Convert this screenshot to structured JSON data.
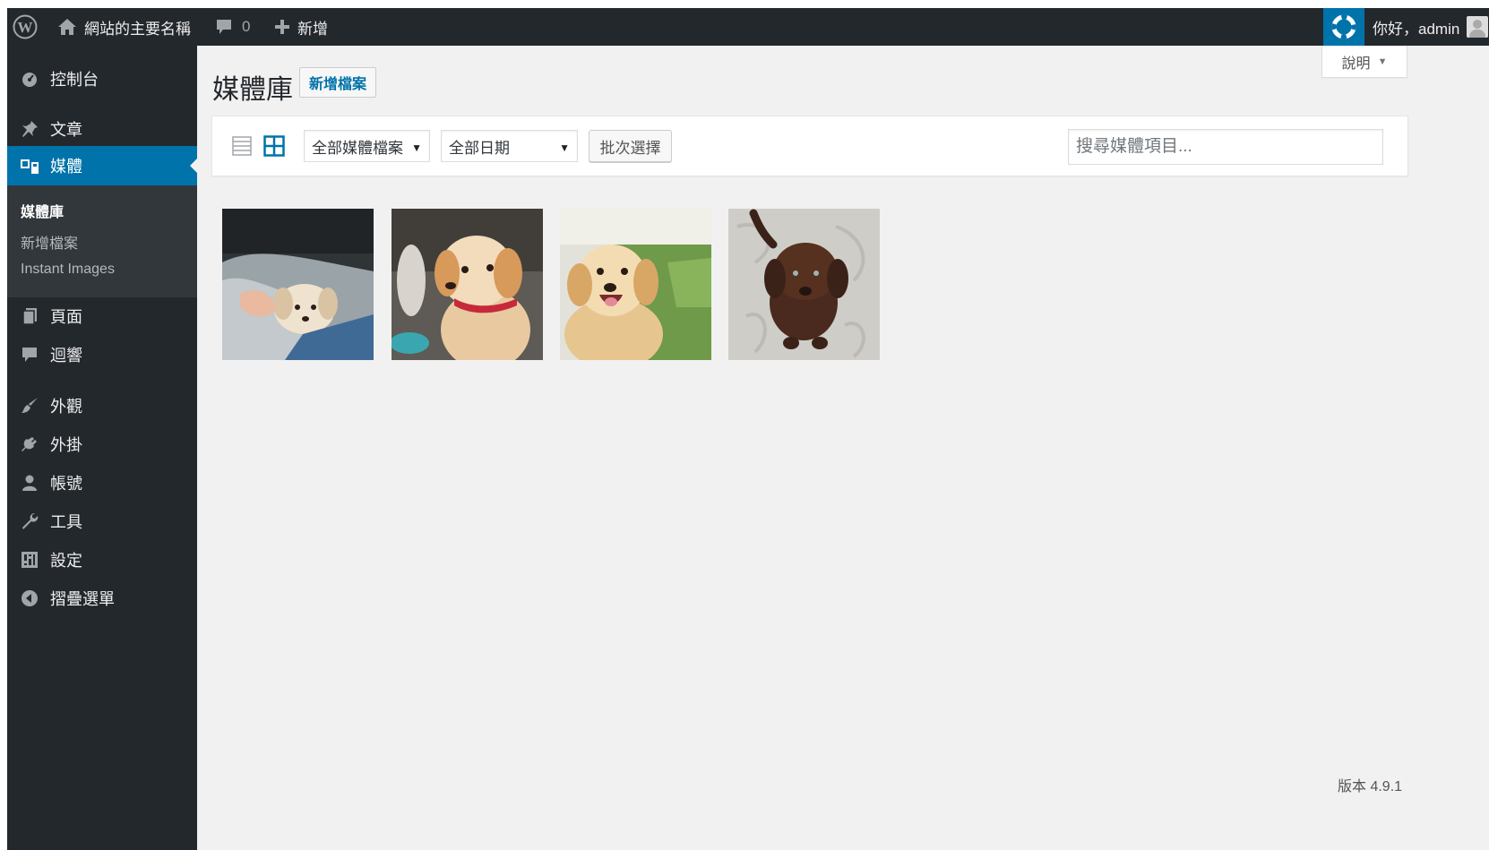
{
  "adminbar": {
    "site_name": "網站的主要名稱",
    "comments_count": "0",
    "new_label": "新增",
    "greeting": "你好，admin",
    "icons": [
      "wordpress-icon",
      "home-icon",
      "comment-icon",
      "plus-icon",
      "help-lifesaver-icon",
      "avatar"
    ]
  },
  "sidebar": {
    "items": [
      {
        "label": "控制台",
        "icon": "dashboard-icon"
      },
      {
        "label": "文章",
        "icon": "pushpin-icon"
      },
      {
        "label": "媒體",
        "icon": "media-icon"
      },
      {
        "label": "頁面",
        "icon": "page-icon"
      },
      {
        "label": "迴響",
        "icon": "comment-icon"
      },
      {
        "label": "外觀",
        "icon": "paintbrush-icon"
      },
      {
        "label": "外掛",
        "icon": "plugin-icon"
      },
      {
        "label": "帳號",
        "icon": "user-icon"
      },
      {
        "label": "工具",
        "icon": "wrench-icon"
      },
      {
        "label": "設定",
        "icon": "settings-icon"
      },
      {
        "label": "摺疊選單",
        "icon": "collapse-icon"
      }
    ],
    "submenu": [
      {
        "label": "媒體庫"
      },
      {
        "label": "新增檔案"
      },
      {
        "label": "Instant Images"
      }
    ]
  },
  "main": {
    "help_tab": "說明",
    "title": "媒體庫",
    "add_new": "新增檔案",
    "filter_type": "全部媒體檔案",
    "filter_date": "全部日期",
    "bulk_select": "批次選擇",
    "search_placeholder": "搜尋媒體項目...",
    "media_items": [
      {
        "alt": "puppy held in arms"
      },
      {
        "alt": "golden puppy with red collar"
      },
      {
        "alt": "golden retriever on grass"
      },
      {
        "alt": "chocolate labrador puppy"
      }
    ]
  },
  "footer": {
    "version": "版本 4.9.1"
  },
  "colors": {
    "admin_bar": "#23282d",
    "sidebar": "#23282d",
    "submenu": "#32373c",
    "accent": "#0073aa",
    "background": "#f1f1f1"
  }
}
